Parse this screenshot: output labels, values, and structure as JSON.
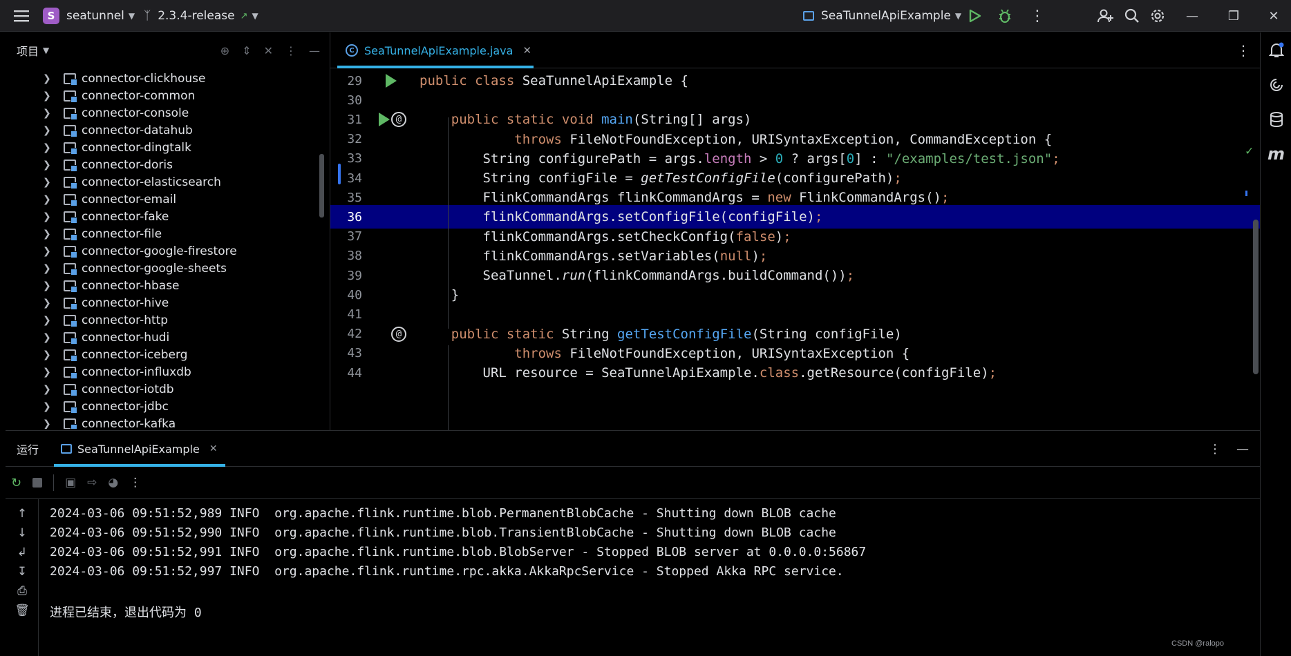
{
  "titlebar": {
    "project_badge": "S",
    "project_name": "seatunnel",
    "branch": "2.3.4-release",
    "run_config": "SeaTunnelApiExample"
  },
  "project_panel": {
    "title": "项目",
    "tree": [
      "connector-clickhouse",
      "connector-common",
      "connector-console",
      "connector-datahub",
      "connector-dingtalk",
      "connector-doris",
      "connector-elasticsearch",
      "connector-email",
      "connector-fake",
      "connector-file",
      "connector-google-firestore",
      "connector-google-sheets",
      "connector-hbase",
      "connector-hive",
      "connector-http",
      "connector-hudi",
      "connector-iceberg",
      "connector-influxdb",
      "connector-iotdb",
      "connector-jdbc",
      "connector-kafka"
    ]
  },
  "editor": {
    "tab_label": "SeaTunnelApiExample.java",
    "line_numbers": [
      "29",
      "30",
      "31",
      "32",
      "33",
      "34",
      "35",
      "36",
      "37",
      "38",
      "39",
      "40",
      "41",
      "42",
      "43",
      "44"
    ],
    "highlighted_line": "36"
  },
  "run_panel": {
    "title": "运行",
    "tab_label": "SeaTunnelApiExample",
    "console": [
      "2024-03-06 09:51:52,989 INFO  org.apache.flink.runtime.blob.PermanentBlobCache - Shutting down BLOB cache",
      "2024-03-06 09:51:52,990 INFO  org.apache.flink.runtime.blob.TransientBlobCache - Shutting down BLOB cache",
      "2024-03-06 09:51:52,991 INFO  org.apache.flink.runtime.blob.BlobServer - Stopped BLOB server at 0.0.0.0:56867",
      "2024-03-06 09:51:52,997 INFO  org.apache.flink.runtime.rpc.akka.AkkaRpcService - Stopped Akka RPC service.",
      "进程已结束，退出代码为 0"
    ]
  },
  "watermark": "CSDN @ralopo",
  "colors": {
    "accent": "#35b1e6",
    "highlight_line": "#00007f",
    "keyword": "#cf8e6d",
    "method": "#56a8f5",
    "string": "#6aab73",
    "number": "#2aacb8",
    "run_green": "#5fb865"
  }
}
